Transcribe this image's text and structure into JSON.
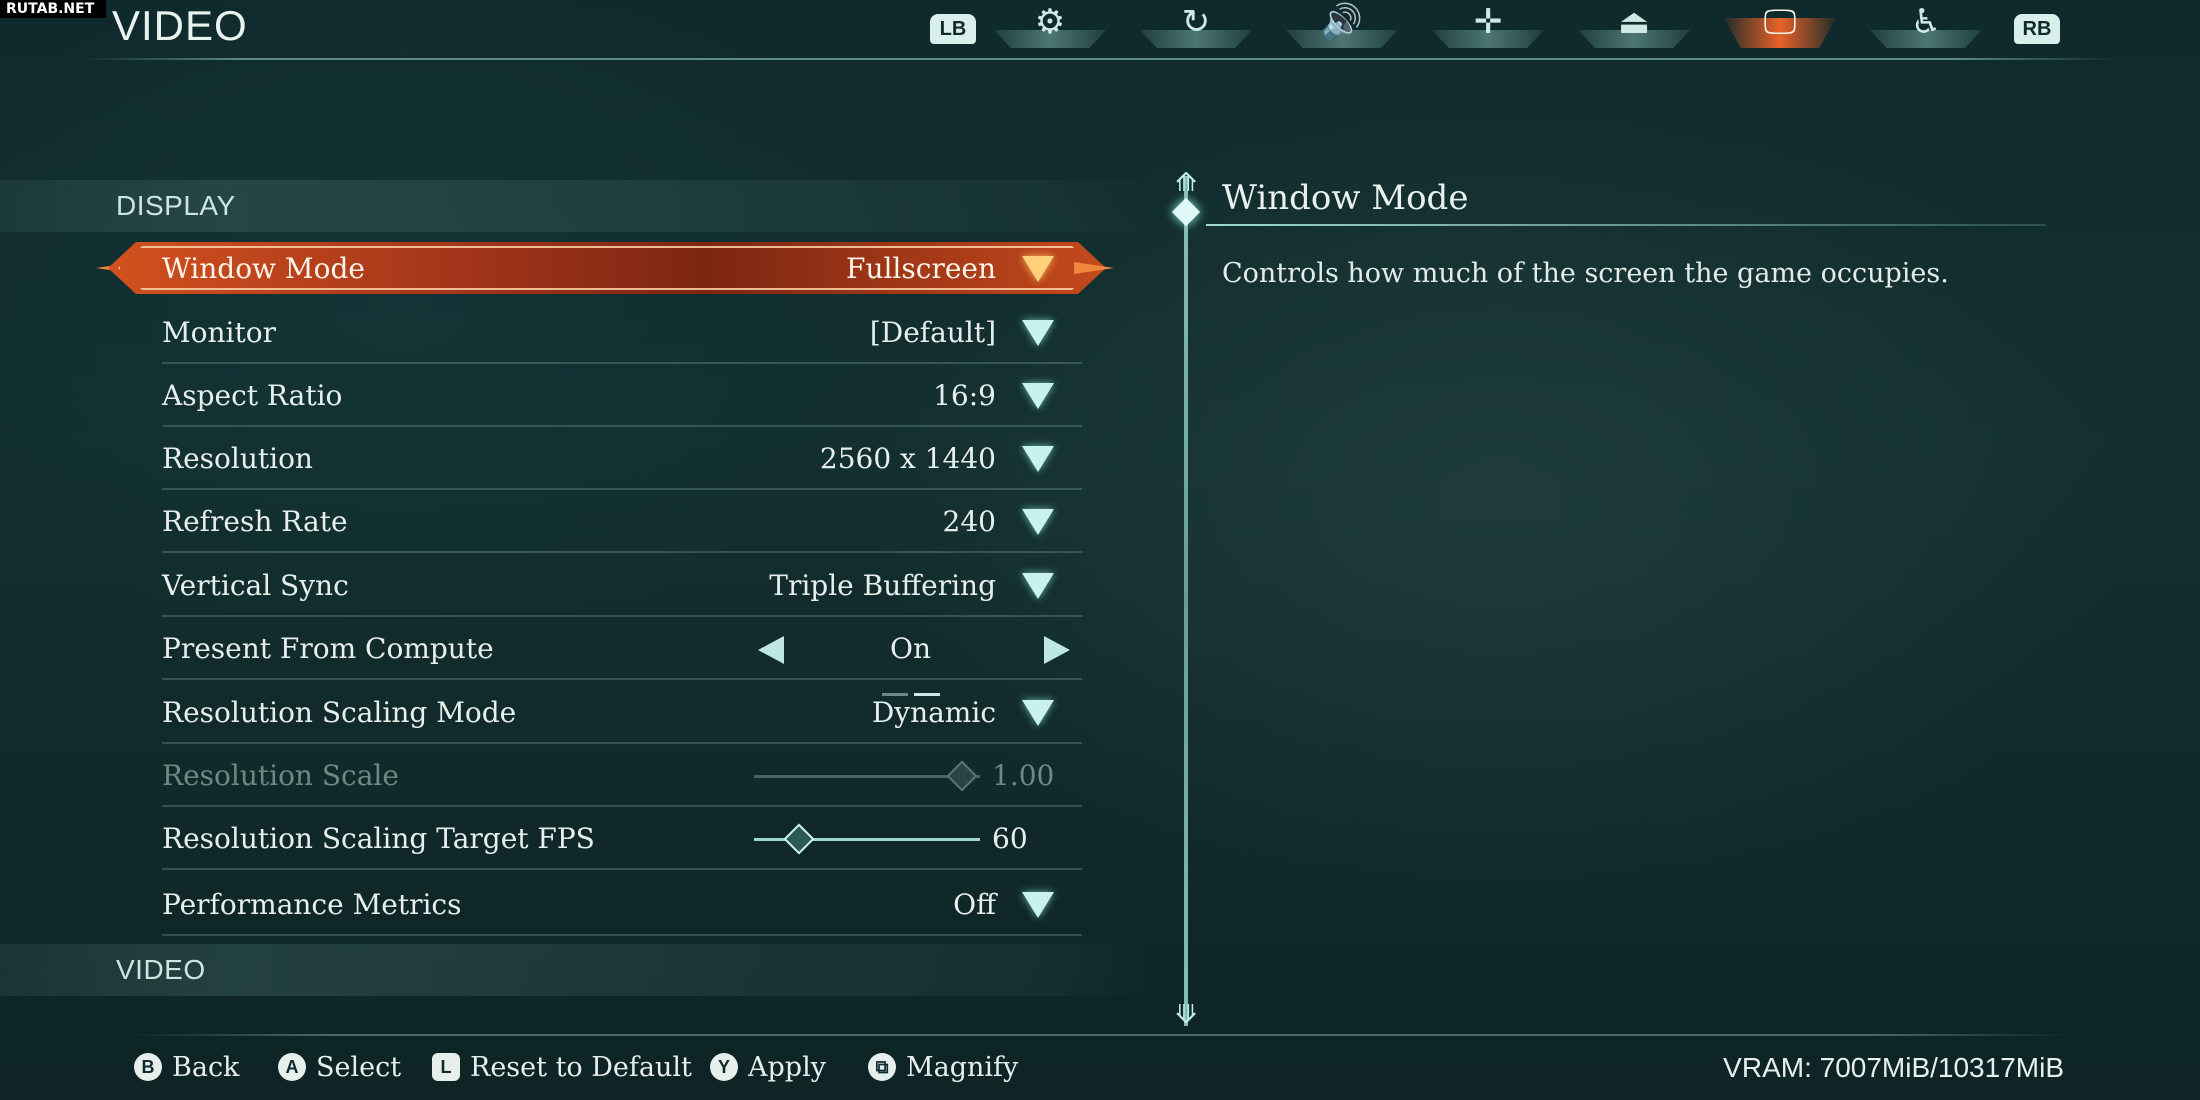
{
  "watermark": "RUTAB.NET",
  "page_title": "VIDEO",
  "tabs": {
    "lb": "LB",
    "rb": "RB",
    "items": [
      {
        "icon": "gears-icon",
        "glyph": "⚙",
        "active": false
      },
      {
        "icon": "controller-swirl-icon",
        "glyph": "↻",
        "active": false
      },
      {
        "icon": "speaker-icon",
        "glyph": "🔊",
        "active": false
      },
      {
        "icon": "move-cross-icon",
        "glyph": "✛",
        "active": false
      },
      {
        "icon": "joystick-icon",
        "glyph": "⏏",
        "active": false
      },
      {
        "icon": "monitor-icon",
        "glyph": "🖵",
        "active": true
      },
      {
        "icon": "accessibility-icon",
        "glyph": "♿",
        "active": false
      }
    ]
  },
  "sections": {
    "display": "DISPLAY",
    "video": "VIDEO"
  },
  "rows": {
    "window_mode": {
      "label": "Window Mode",
      "value": "Fullscreen"
    },
    "monitor": {
      "label": "Monitor",
      "value": "[Default]"
    },
    "aspect_ratio": {
      "label": "Aspect Ratio",
      "value": "16:9"
    },
    "resolution": {
      "label": "Resolution",
      "value": "2560 x 1440"
    },
    "refresh_rate": {
      "label": "Refresh Rate",
      "value": "240"
    },
    "vertical_sync": {
      "label": "Vertical Sync",
      "value": "Triple Buffering"
    },
    "present_from_compute": {
      "label": "Present From Compute",
      "value": "On"
    },
    "resolution_scaling_mode": {
      "label": "Resolution Scaling Mode",
      "value": "Dynamic"
    },
    "resolution_scale": {
      "label": "Resolution Scale",
      "value": "1.00",
      "level": 1.0
    },
    "resolution_scaling_target_fps": {
      "label": "Resolution Scaling Target FPS",
      "value": "60",
      "level": 0.2
    },
    "performance_metrics": {
      "label": "Performance Metrics",
      "value": "Off"
    }
  },
  "detail": {
    "title": "Window Mode",
    "description": "Controls how much of the screen the game occupies."
  },
  "footer": {
    "back": {
      "button": "B",
      "label": "Back"
    },
    "select": {
      "button": "A",
      "label": "Select"
    },
    "reset": {
      "button": "L",
      "label": "Reset to Default"
    },
    "apply": {
      "button": "Y",
      "label": "Apply"
    },
    "magnify": {
      "button": "⧉",
      "label": "Magnify"
    },
    "vram": "VRAM: 7007MiB/10317MiB"
  },
  "colors": {
    "accent_active": "#d2511f",
    "teal_accent": "#9fd8d2",
    "background": "#132f30"
  }
}
